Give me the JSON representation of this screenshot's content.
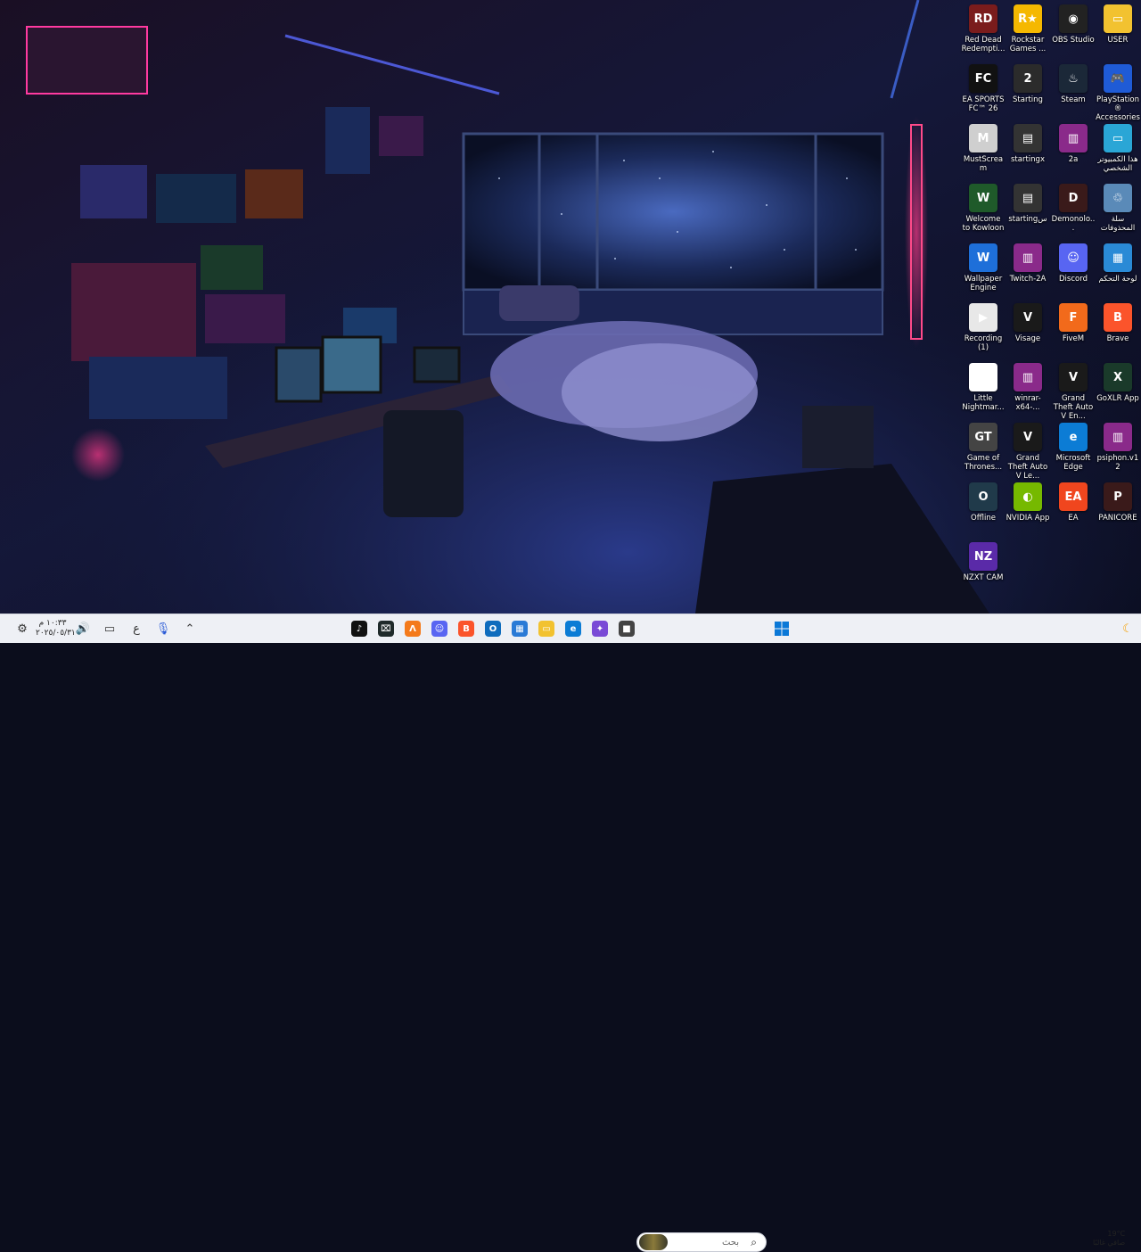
{
  "desktop_icons": [
    {
      "label": "Red Dead Redempti...",
      "icon": "red-dead-redemption-icon",
      "color": "#7a1c1c",
      "glyph": "RD"
    },
    {
      "label": "Rockstar Games ...",
      "icon": "rockstar-icon",
      "color": "#f5b800",
      "glyph": "R★"
    },
    {
      "label": "OBS Studio",
      "icon": "obs-icon",
      "color": "#222222",
      "glyph": "◉"
    },
    {
      "label": "USER",
      "icon": "folder-icon",
      "color": "#f2c230",
      "glyph": "▭"
    },
    {
      "label": "EA SPORTS FC™ 26",
      "icon": "ea-fc-icon",
      "color": "#111111",
      "glyph": "FC"
    },
    {
      "label": "Starting",
      "icon": "starting-icon",
      "color": "#2b2b2b",
      "glyph": "2"
    },
    {
      "label": "Steam",
      "icon": "steam-icon",
      "color": "#1b2838",
      "glyph": "♨"
    },
    {
      "label": "PlayStation® Accessories",
      "icon": "playstation-icon",
      "color": "#1f5bd6",
      "glyph": "🎮"
    },
    {
      "label": "MustScream",
      "icon": "mustscream-icon",
      "color": "#cfcfcf",
      "glyph": "M"
    },
    {
      "label": "startingx",
      "icon": "startingx-icon",
      "color": "#333333",
      "glyph": "▤"
    },
    {
      "label": "2a",
      "icon": "winrar-icon",
      "color": "#8a2a8a",
      "glyph": "▥"
    },
    {
      "label": "هذا الكمبيوتر الشخصي",
      "icon": "this-pc-icon",
      "color": "#2aa6d6",
      "glyph": "▭"
    },
    {
      "label": "Welcome to Kowloon",
      "icon": "kowloon-icon",
      "color": "#1f5a2a",
      "glyph": "W"
    },
    {
      "label": "startingس",
      "icon": "startings-icon",
      "color": "#333333",
      "glyph": "▤"
    },
    {
      "label": "Demonolo...",
      "icon": "demonologist-icon",
      "color": "#3a1a1a",
      "glyph": "D"
    },
    {
      "label": "سلة المحذوفات",
      "icon": "recycle-bin-icon",
      "color": "#5a8ab8",
      "glyph": "♲"
    },
    {
      "label": "Wallpaper Engine",
      "icon": "wallpaper-engine-icon",
      "color": "#1e6fd9",
      "glyph": "W"
    },
    {
      "label": "Twitch-2A",
      "icon": "winrar-icon",
      "color": "#8a2a8a",
      "glyph": "▥"
    },
    {
      "label": "Discord",
      "icon": "discord-icon",
      "color": "#5865f2",
      "glyph": "☺"
    },
    {
      "label": "لوحة التحكم",
      "icon": "control-panel-icon",
      "color": "#2a8ad6",
      "glyph": "▦"
    },
    {
      "label": "Recording (1)",
      "icon": "video-file-icon",
      "color": "#e8e8e8",
      "glyph": "▶"
    },
    {
      "label": "Visage",
      "icon": "visage-icon",
      "color": "#1a1a1a",
      "glyph": "V"
    },
    {
      "label": "FiveM",
      "icon": "fivem-icon",
      "color": "#f26a1b",
      "glyph": "F"
    },
    {
      "label": "Brave",
      "icon": "brave-icon",
      "color": "#fb542b",
      "glyph": "B"
    },
    {
      "label": "Little Nightmar...",
      "icon": "little-nightmares-icon",
      "color": "#ffffff",
      "glyph": "☗"
    },
    {
      "label": "winrar-x64-...",
      "icon": "winrar-icon",
      "color": "#8a2a8a",
      "glyph": "▥"
    },
    {
      "label": "Grand Theft Auto V En...",
      "icon": "gta-v-icon",
      "color": "#1a1a1a",
      "glyph": "V"
    },
    {
      "label": "GoXLR App",
      "icon": "goxlr-icon",
      "color": "#1a3a2a",
      "glyph": "X"
    },
    {
      "label": "Game of Thrones...",
      "icon": "game-of-thrones-icon",
      "color": "#444444",
      "glyph": "GT"
    },
    {
      "label": "Grand Theft Auto V Le...",
      "icon": "gta-v-icon",
      "color": "#1a1a1a",
      "glyph": "V"
    },
    {
      "label": "Microsoft Edge",
      "icon": "edge-icon",
      "color": "#0c7cd5",
      "glyph": "e"
    },
    {
      "label": "psiphon.v12",
      "icon": "winrar-icon",
      "color": "#8a2a8a",
      "glyph": "▥"
    },
    {
      "label": "Offline",
      "icon": "offline-icon",
      "color": "#203a4a",
      "glyph": "O"
    },
    {
      "label": "NVIDIA App",
      "icon": "nvidia-icon",
      "color": "#76b900",
      "glyph": "◐"
    },
    {
      "label": "EA",
      "icon": "ea-icon",
      "color": "#f0461e",
      "glyph": "EA"
    },
    {
      "label": "PANICORE",
      "icon": "panicore-icon",
      "color": "#3a1a1a",
      "glyph": "P"
    },
    {
      "label": "NZXT CAM",
      "icon": "nzxt-cam-icon",
      "color": "#5a2aa8",
      "glyph": "NZ"
    }
  ],
  "taskbar": {
    "start_icon": "windows-start-icon",
    "search_text": "بحث",
    "pinned": [
      {
        "icon": "tiktok-icon",
        "color": "#111111",
        "glyph": "♪"
      },
      {
        "icon": "terminal-icon",
        "color": "#1f2a2a",
        "glyph": "⌧"
      },
      {
        "icon": "app-icon",
        "color": "#f47a1b",
        "glyph": "Λ"
      },
      {
        "icon": "discord-icon",
        "color": "#5865f2",
        "glyph": "☺"
      },
      {
        "icon": "brave-icon",
        "color": "#fb542b",
        "glyph": "B"
      },
      {
        "icon": "outlook-icon",
        "color": "#0f6cbd",
        "glyph": "O"
      },
      {
        "icon": "microsoft-store-icon",
        "color": "#2a7ad6",
        "glyph": "▦"
      },
      {
        "icon": "file-explorer-icon",
        "color": "#f2c230",
        "glyph": "▭"
      },
      {
        "icon": "edge-icon",
        "color": "#0c7cd5",
        "glyph": "e"
      },
      {
        "icon": "copilot-icon",
        "color": "#7a4ad6",
        "glyph": "✦"
      },
      {
        "icon": "window-icon",
        "color": "#444444",
        "glyph": "■"
      }
    ],
    "clock": {
      "time": "١٠:٣٣ م",
      "date": "٢٠٢٥/٠٥/٣١"
    },
    "language": "ع",
    "weather": {
      "temp": "19°C",
      "condition": "صافي غالبًا"
    }
  }
}
